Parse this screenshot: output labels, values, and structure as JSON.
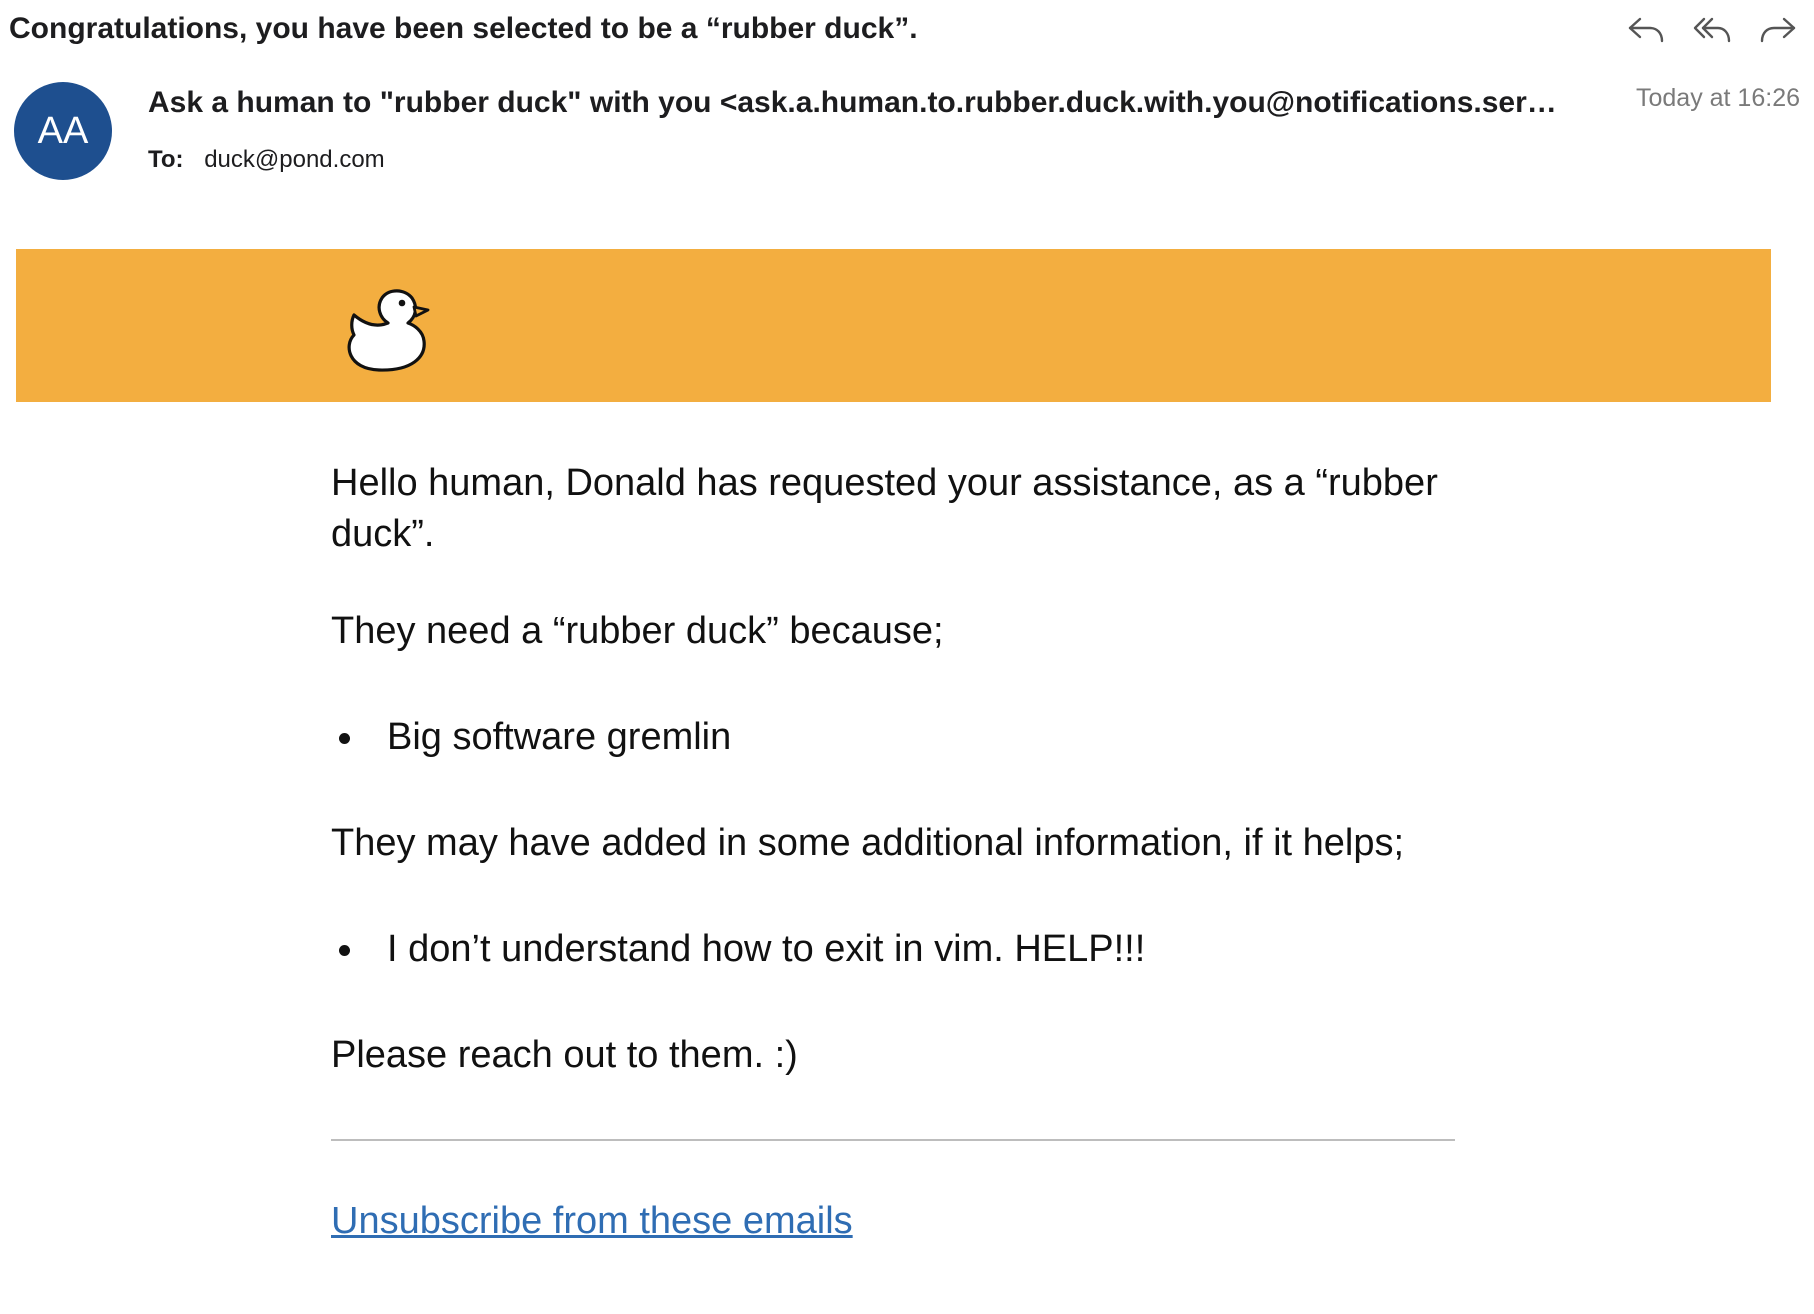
{
  "email": {
    "subject": "Congratulations, you have been selected to be a “rubber duck”.",
    "sender_initials": "AA",
    "from": "Ask a human to \"rubber duck\" with you <ask.a.human.to.rubber.duck.with.you@notifications.servic...",
    "timestamp": "Today at 16:26",
    "to_label": "To:",
    "to_address": "duck@pond.com"
  },
  "actions": {
    "reply_icon": "reply-icon",
    "reply_all_icon": "reply-all-icon",
    "forward_icon": "forward-icon"
  },
  "banner": {
    "color": "#f3ae40",
    "logo_icon": "rubber-duck-icon"
  },
  "body": {
    "greeting": "Hello human, Donald has requested your assistance, as a “rubber duck”.",
    "reason_heading": "They need a “rubber duck” because;",
    "reasons": [
      "Big software gremlin"
    ],
    "info_heading": "They may have added in some additional information, if it helps;",
    "infos": [
      "I don’t understand how to exit in vim. HELP!!!"
    ],
    "closing": "Please reach out to them. :)",
    "unsubscribe": "Unsubscribe from these emails"
  },
  "colors": {
    "avatar": "#1e4f8f",
    "link": "#2f6db3"
  }
}
